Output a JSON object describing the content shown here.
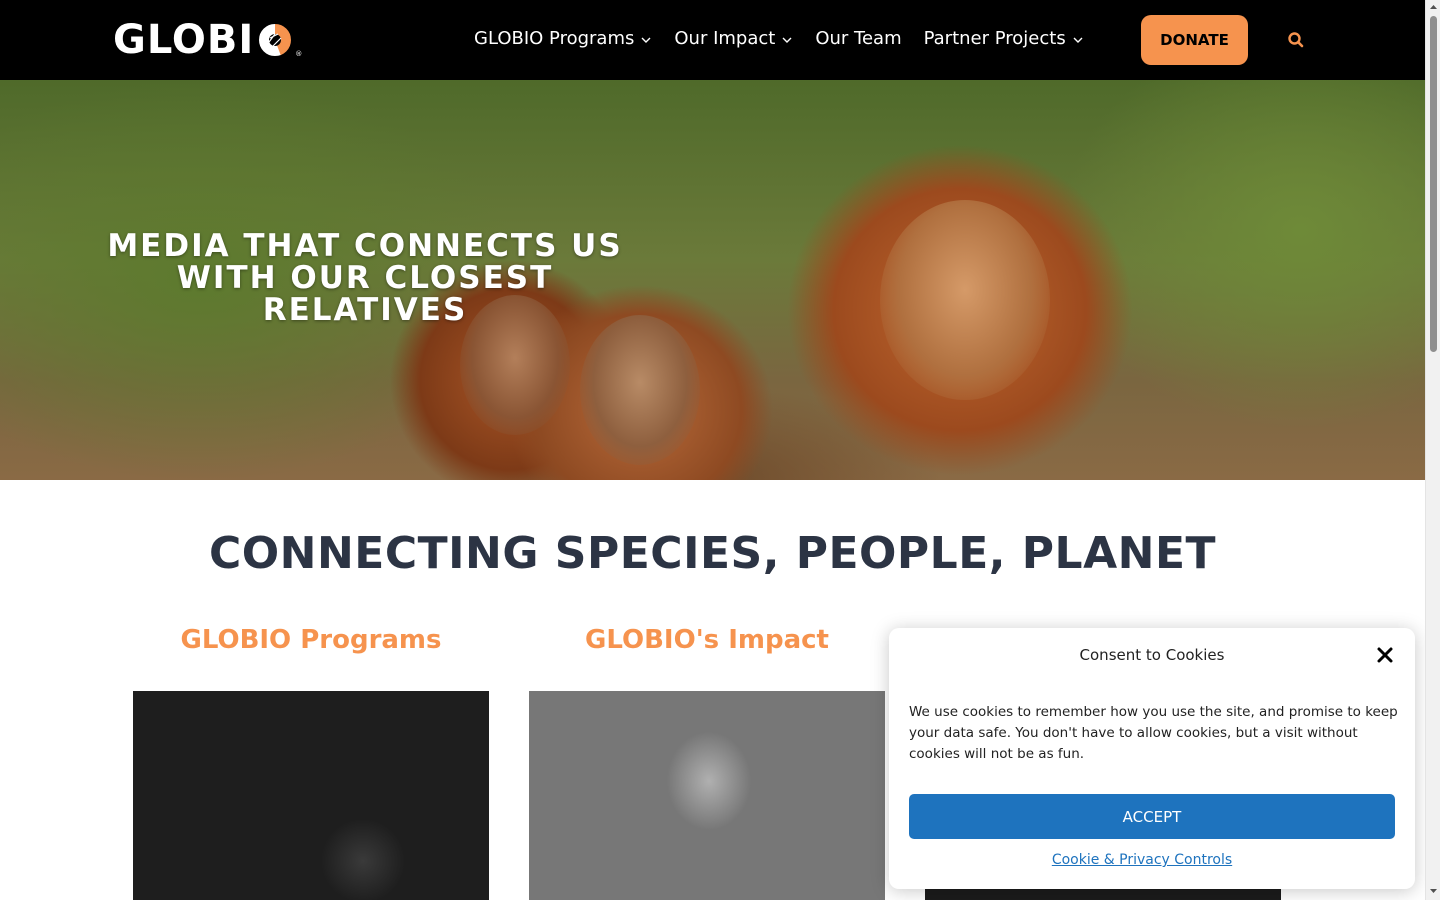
{
  "header": {
    "logo_text": "GLOBI",
    "logo_reg": "®",
    "nav": [
      {
        "label": "GLOBIO Programs",
        "has_dropdown": true
      },
      {
        "label": "Our Impact",
        "has_dropdown": true
      },
      {
        "label": "Our Team",
        "has_dropdown": false
      },
      {
        "label": "Partner Projects",
        "has_dropdown": true
      }
    ],
    "donate_label": "DONATE",
    "search_icon": "search-icon"
  },
  "hero": {
    "title": "MEDIA THAT CONNECTS US WITH OUR CLOSEST RELATIVES"
  },
  "main": {
    "heading": "CONNECTING SPECIES, PEOPLE, PLANET",
    "columns": [
      {
        "title": "GLOBIO Programs"
      },
      {
        "title": "GLOBIO's Impact"
      }
    ]
  },
  "cookie": {
    "title": "Consent to Cookies",
    "body": "We use cookies to remember how you use the site, and promise to keep your data safe. You don't have to allow cookies, but a visit without cookies will not be as fun.",
    "accept_label": "ACCEPT",
    "link_label": "Cookie & Privacy Controls"
  },
  "colors": {
    "accent": "#f6934e",
    "heading": "#2c3444",
    "primary_button": "#1e73be",
    "header_bg": "#000000"
  }
}
